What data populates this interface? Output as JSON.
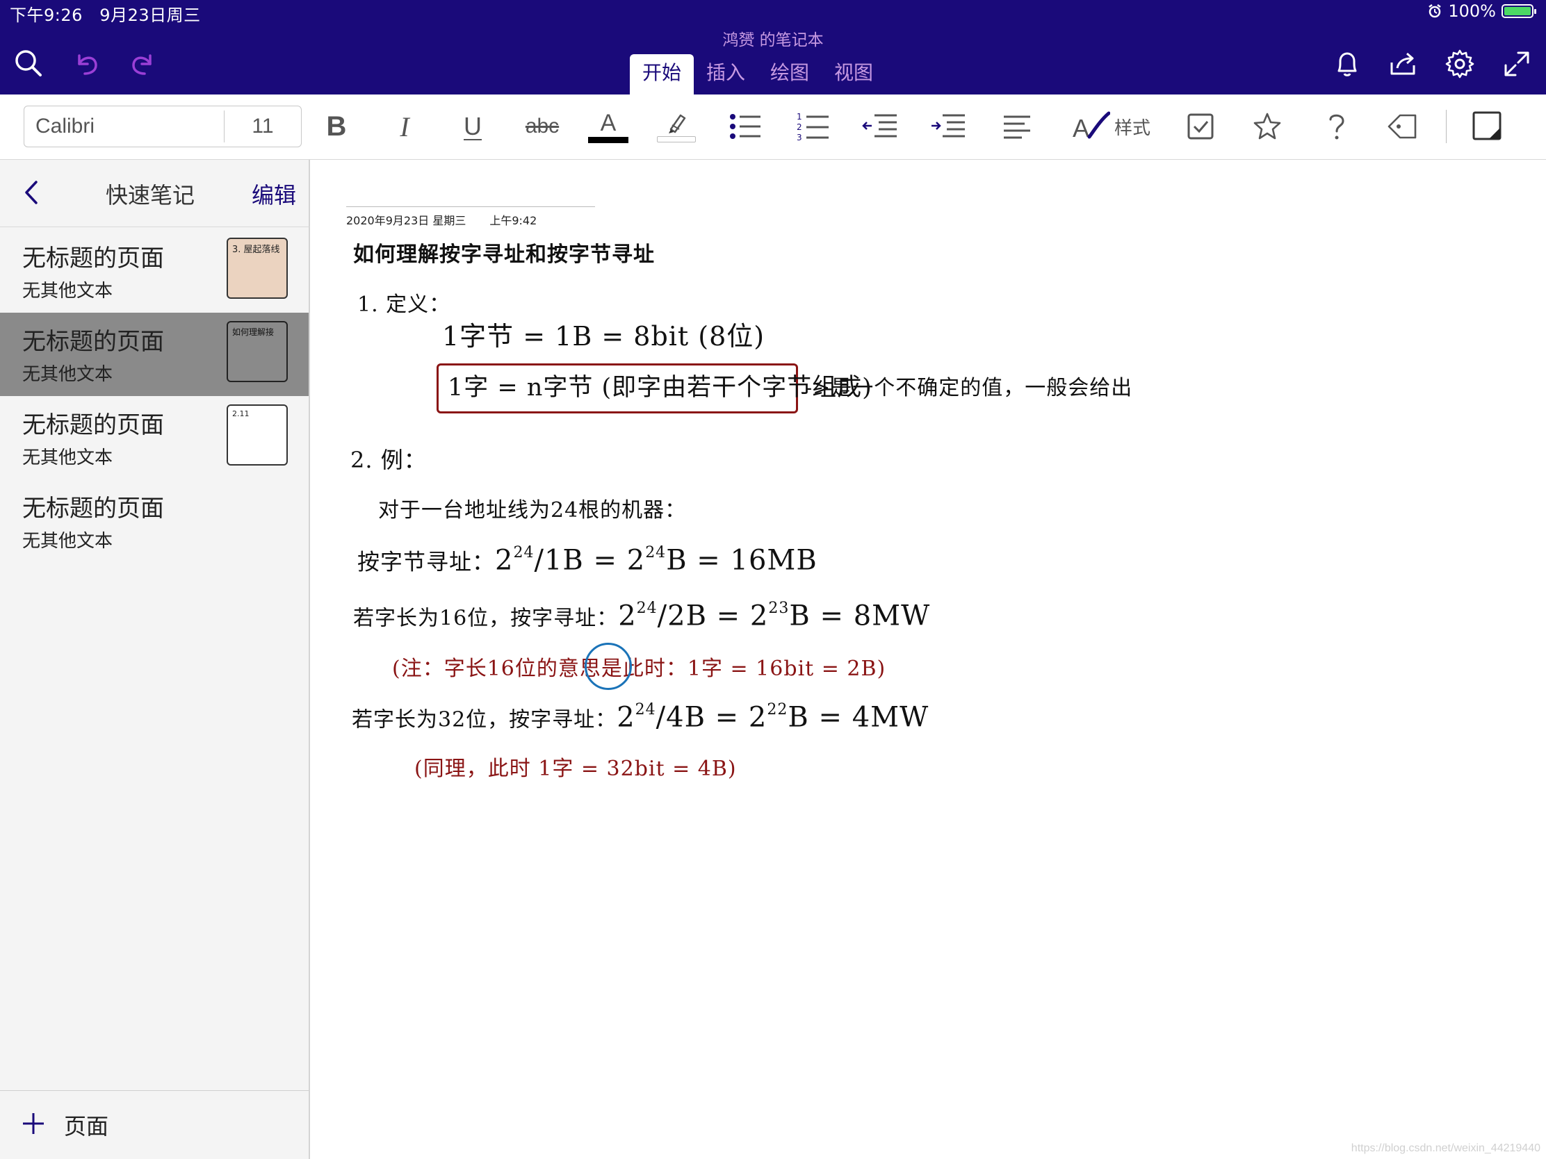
{
  "status_bar": {
    "time": "下午9:26",
    "date": "9月23日周三",
    "battery": "100%",
    "alarm_icon": "alarm-icon"
  },
  "header": {
    "notebook_title": "鸿赟 的笔记本",
    "tabs": [
      {
        "label": "开始",
        "active": true
      },
      {
        "label": "插入",
        "active": false
      },
      {
        "label": "绘图",
        "active": false
      },
      {
        "label": "视图",
        "active": false
      }
    ],
    "left_icons": [
      "search-icon",
      "undo-icon",
      "redo-icon"
    ],
    "right_icons": [
      "bell-icon",
      "share-icon",
      "gear-icon",
      "fullscreen-icon"
    ]
  },
  "ribbon": {
    "font_name": "Calibri",
    "font_size": "11",
    "bold": "B",
    "italic": "I",
    "underline": "U",
    "strike": "abc",
    "font_color": "A",
    "style_label": "样式",
    "font_color_hex": "#000000"
  },
  "sidebar": {
    "title": "快速笔记",
    "edit": "编辑",
    "pages": [
      {
        "title": "无标题的页面",
        "subtitle": "无其他文本",
        "selected": false,
        "thumb": "3. 屋起落线"
      },
      {
        "title": "无标题的页面",
        "subtitle": "无其他文本",
        "selected": true,
        "thumb": "如何理解接"
      },
      {
        "title": "无标题的页面",
        "subtitle": "无其他文本",
        "selected": false,
        "thumb": "2.11"
      },
      {
        "title": "无标题的页面",
        "subtitle": "无其他文本",
        "selected": false,
        "thumb": ""
      }
    ],
    "add_page": "页面"
  },
  "note": {
    "date": "2020年9月23日 星期三",
    "time": "上午9:42",
    "title": "如何理解按字寻址和按字节寻址",
    "s1_heading": "1. 定义：",
    "def_byte": "1字节 = 1B = 8bit (8位)",
    "def_word": "1字 = n字节 (即字由若干个字节组成)",
    "def_note": "->是一个不确定的值，一般会给出",
    "s2_heading": "2. 例：",
    "example_intro": "对于一台地址线为24根的机器：",
    "byte_addr_label": "按字节寻址：",
    "byte_addr_expr_a": "2",
    "byte_addr_exp_a": "24",
    "byte_addr_expr_b": "/1B = 2",
    "byte_addr_exp_b": "24",
    "byte_addr_expr_c": "B = 16MB",
    "w16_label": "若字长为16位，按字寻址：",
    "w16_expr_a": "2",
    "w16_exp_a": "24",
    "w16_expr_b": "/2B = 2",
    "w16_exp_b": "23",
    "w16_expr_c": "B = 8MW",
    "w16_note_a": "(注：字长16位的意思是",
    "w16_note_b": "此时",
    "w16_note_c": "：1字 = 16bit = 2B)",
    "w32_label": "若字长为32位，按字寻址：",
    "w32_expr_a": "2",
    "w32_exp_a": "24",
    "w32_expr_b": "/4B = 2",
    "w32_exp_b": "22",
    "w32_expr_c": "B = 4MW",
    "w32_note": "(同理，此时 1字 = 32bit = 4B)",
    "ink_colors": {
      "black": "#111111",
      "red": "#8a1414",
      "blue": "#1a73b8"
    }
  },
  "watermark": "https://blog.csdn.net/weixin_44219440"
}
